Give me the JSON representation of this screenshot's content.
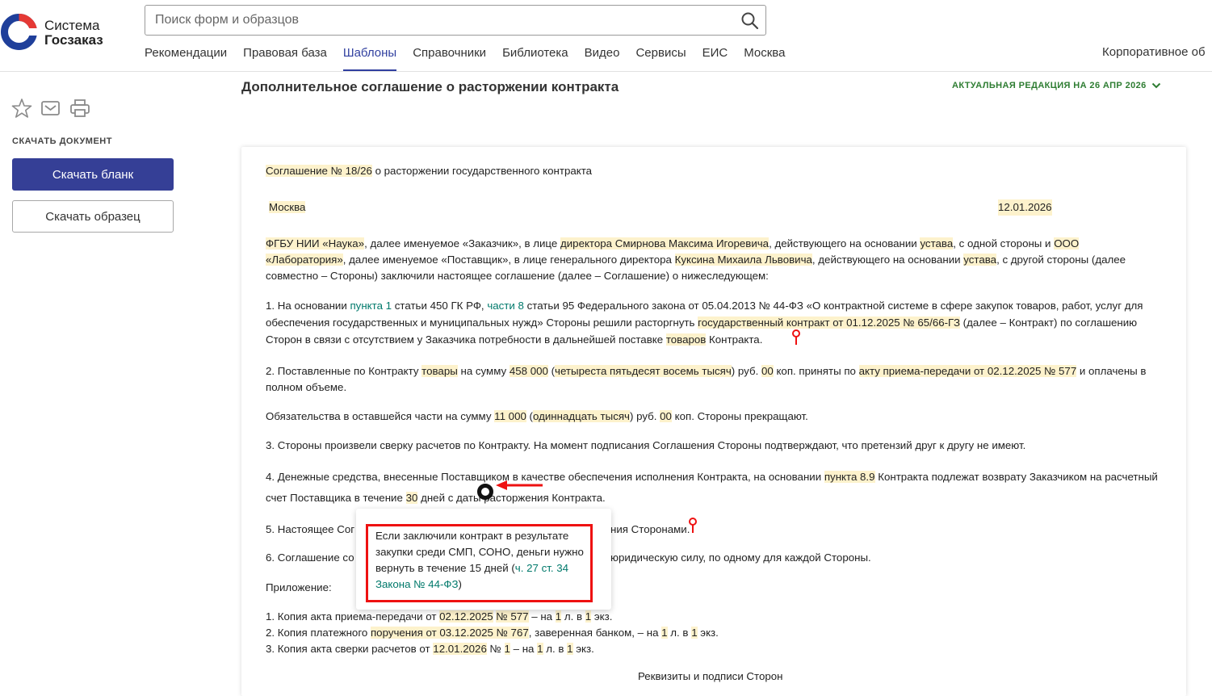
{
  "logo": {
    "line1": "Система",
    "line2": "Госзаказ"
  },
  "search": {
    "placeholder": "Поиск форм и образцов"
  },
  "nav": {
    "items": [
      "Рекомендации",
      "Правовая база",
      "Шаблоны",
      "Справочники",
      "Библиотека",
      "Видео",
      "Сервисы",
      "ЕИС",
      "Москва"
    ],
    "active": "Шаблоны",
    "corporate": "Корпоративное об"
  },
  "sidebar": {
    "download_label": "СКАЧАТЬ ДОКУМЕНТ",
    "download_blank": "Скачать бланк",
    "download_sample": "Скачать образец"
  },
  "doc": {
    "title": "Дополнительное соглашение о расторжении контракта",
    "edition": "АКТУАЛЬНАЯ РЕДАКЦИЯ НА 26 АПР 2026",
    "agreement_no": "Соглашение № 18/26",
    "agreement_rest": " о расторжении государственного контракта",
    "city": "Москва",
    "date": "12.01.2026",
    "p_parties": {
      "customer": "ФГБУ НИИ «Наука»",
      "t1": ", далее именуемое «Заказчик», в лице ",
      "customer_rep": "директора Смирнова Максима Игоревича",
      "t2": ", действующего на основании ",
      "basis1": "устава",
      "t3": ", с одной стороны и ",
      "supplier": "ООО «Лаборатория»",
      "t4": ", далее именуемое «Поставщик», в лице генерального директора ",
      "supplier_rep": "Куксина Михаила Львовича",
      "t5": ", действующего на основании ",
      "basis2": "устава",
      "t6": ", с другой стороны (далее совместно – Стороны) заключили настоящее соглашение (далее – Соглашение) о нижеследующем:"
    },
    "p1": {
      "t1": "1. На основании ",
      "link1": "пункта 1",
      "t2": " статьи 450 ГК РФ, ",
      "link2": "части 8",
      "t3": " статьи 95 Федерального закона от 05.04.2013 № 44-ФЗ «О контрактной системе в сфере закупок товаров, работ, услуг для обеспечения государственных и муниципальных нужд» Стороны решили расторгнуть ",
      "contract": "государственный контракт от 01.12.2025 № 65/66-ГЗ",
      "t4": " (далее – Контракт) по соглашению Сторон в связи с отсутствием у Заказчика потребности в дальнейшей поставке ",
      "goods": "товаров",
      "t5": " Контракта."
    },
    "p2": {
      "t1": "2. Поставленные по Контракту ",
      "goods": "товары",
      "t2": " на сумму ",
      "sum": "458 000",
      "t3": " (",
      "sum_words": "четыреста пятьдесят восемь тысяч",
      "t4": ") руб. ",
      "kop": "00",
      "t5": " коп. приняты по ",
      "act": "акту приема-передачи от 02.12.2025 № 577",
      "t6": " и оплачены в полном объеме."
    },
    "p_oblig": {
      "t1": "Обязательства в оставшейся части на сумму ",
      "sum": "11 000",
      "t2": " (",
      "sum_words": "одиннадцать тысяч",
      "t3": ") руб. ",
      "kop": "00",
      "t4": " коп. Стороны прекращают."
    },
    "p3": "3. Стороны произвели сверку расчетов по Контракту. На момент подписания Соглашения Стороны подтверждают, что претензий друг к другу не имеют.",
    "p4": {
      "t1": "4. Денежные средства, внесенные Поставщиком в качестве обеспечения исполнения Контракта, на основании ",
      "clause": "пункта 8.9",
      "t2": " Контракта подлежат возврату Заказчиком на расчетный счет Поставщика в течение ",
      "days": "30",
      "t3": " дней с даты расторжения Контракта."
    },
    "p5_start": "5. Настоящее Сог",
    "p5_end": "ния Сторонами.",
    "p6_start": "6. Соглашение со",
    "p6_end": "юридическую силу, по одному для каждой Стороны.",
    "appendix_label": "Приложение:",
    "appendix": [
      {
        "t1": "1. Копия акта приема-передачи от ",
        "h1": "02.12.2025",
        "t2": " ",
        "h2": "№ 577",
        "t3": " – на ",
        "h3": "1",
        "t4": " л. в ",
        "h4": "1",
        "t5": " экз."
      },
      {
        "t1": "2. Копия платежного ",
        "h1": "поручения от 03.12.2025 № 767",
        "t2": ", заверенная банком, – на ",
        "h2": "1",
        "t3": " л. в ",
        "h3": "1",
        "t4": " экз."
      },
      {
        "t1": "3. Копия акта сверки расчетов от ",
        "h1": "12.01.2026",
        "t2": " № ",
        "h2": "1",
        "t3": " – на ",
        "h3": "1",
        "t4": " л. в ",
        "h4": "1",
        "t5": " экз."
      }
    ],
    "signatures_head": "Реквизиты и подписи Сторон"
  },
  "tooltip": {
    "text": "Если заключили контракт в результате закупки среди СМП, СОНО, деньги нужно вернуть в течение 15 дней (",
    "link": "ч. 27 ст. 34 Закона № 44-ФЗ",
    "close": ")"
  },
  "colors": {
    "brand": "#353f96",
    "accent_green": "#2e7d32",
    "link": "#00796b",
    "highlight": "#fdf2cc",
    "annotation_red": "#e11111"
  },
  "icons": [
    "star-icon",
    "mail-icon",
    "print-icon",
    "search-icon",
    "chevron-down-icon",
    "location-pin-icon",
    "arrow-left-icon"
  ]
}
